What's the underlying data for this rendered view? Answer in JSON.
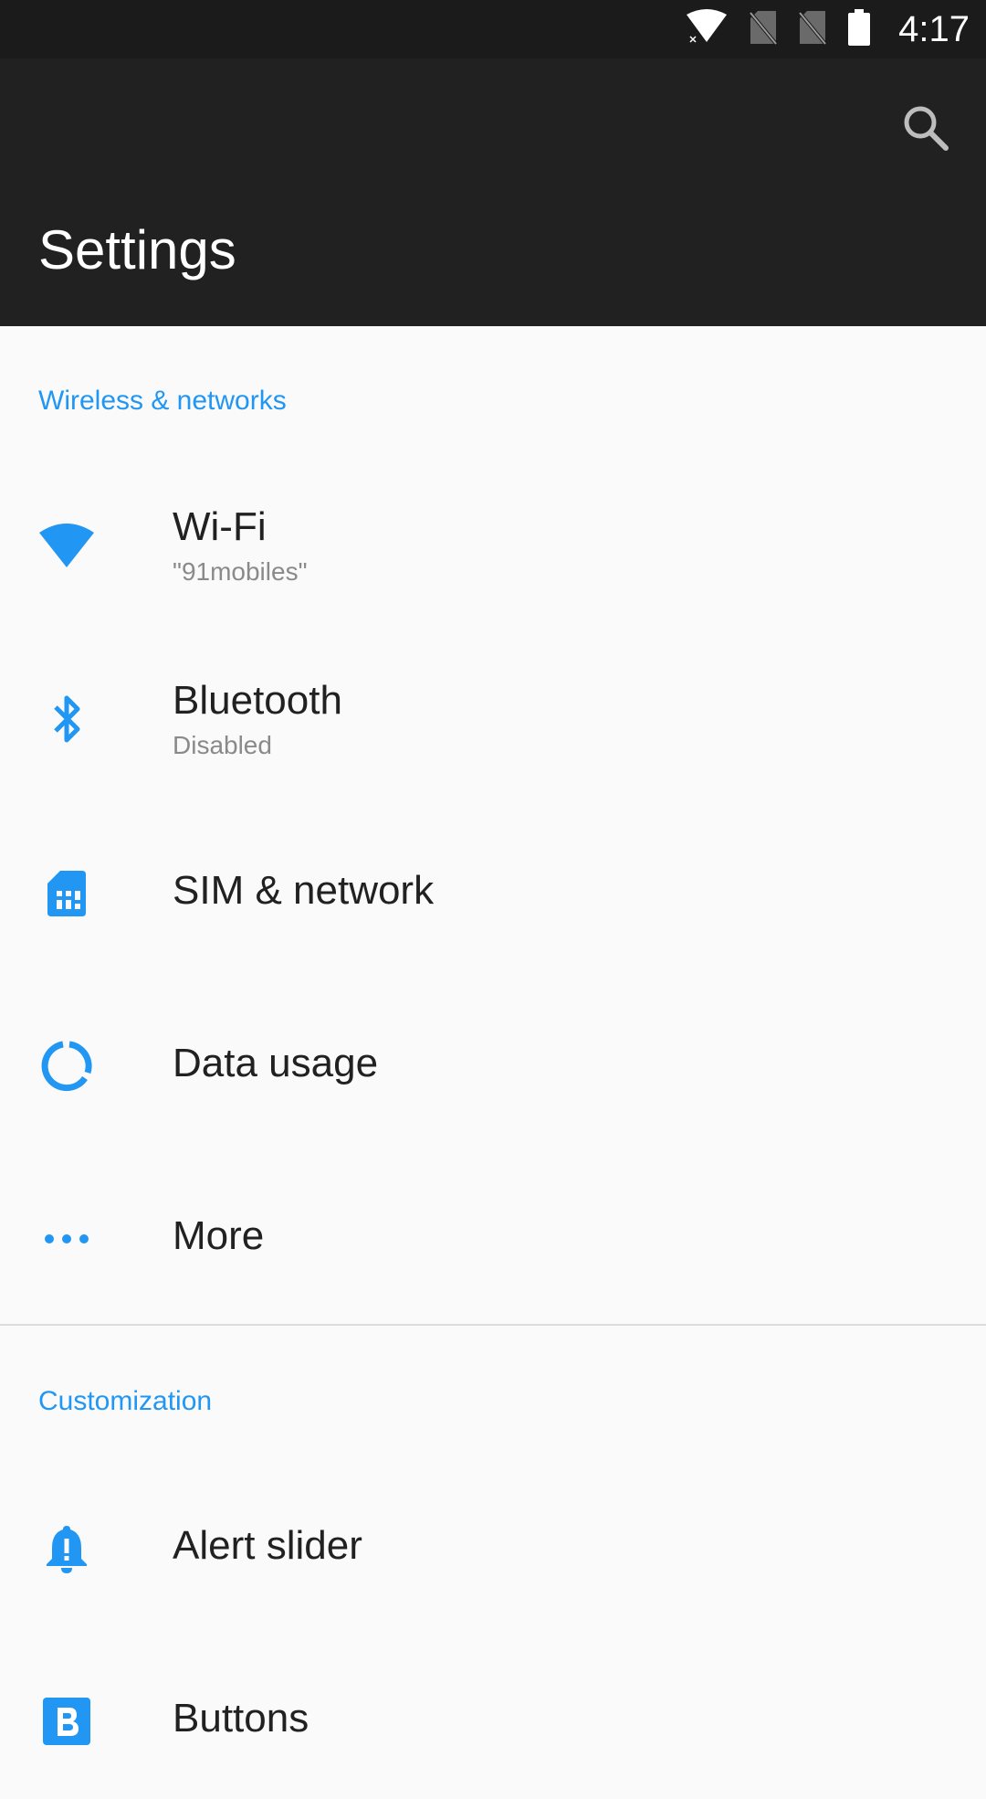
{
  "status_bar": {
    "time": "4:17",
    "icons": [
      "wifi-icon",
      "no-sim-icon",
      "no-sim-icon",
      "battery-icon"
    ]
  },
  "toolbar": {
    "title": "Settings",
    "search_icon": "search-icon"
  },
  "sections": [
    {
      "header": "Wireless & networks",
      "items": [
        {
          "title": "Wi-Fi",
          "summary": "\"91mobiles\"",
          "icon": "wifi-icon"
        },
        {
          "title": "Bluetooth",
          "summary": "Disabled",
          "icon": "bluetooth-icon"
        },
        {
          "title": "SIM & network",
          "icon": "sim-card-icon"
        },
        {
          "title": "Data usage",
          "icon": "data-usage-icon"
        },
        {
          "title": "More",
          "icon": "more-horizontal-icon"
        }
      ]
    },
    {
      "header": "Customization",
      "items": [
        {
          "title": "Alert slider",
          "icon": "alert-bell-icon"
        },
        {
          "title": "Buttons",
          "icon": "buttons-b-icon"
        }
      ]
    }
  ],
  "colors": {
    "accent": "#2196f3",
    "toolbar_bg": "#212121",
    "status_bg": "#1b1b1b",
    "page_bg": "#fafafa",
    "title_text": "#212121",
    "summary_text": "#8a8a8a"
  }
}
